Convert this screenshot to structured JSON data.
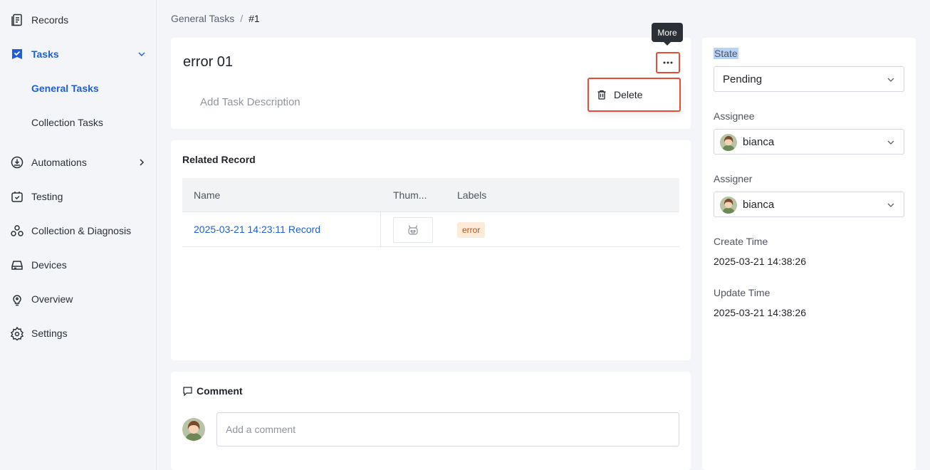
{
  "sidebar": {
    "items": [
      {
        "label": "Records",
        "icon": "records-icon"
      },
      {
        "label": "Tasks",
        "icon": "tasks-icon"
      },
      {
        "label": "Automations",
        "icon": "automations-icon"
      },
      {
        "label": "Testing",
        "icon": "testing-icon"
      },
      {
        "label": "Collection & Diagnosis",
        "icon": "diagnosis-icon"
      },
      {
        "label": "Devices",
        "icon": "devices-icon"
      },
      {
        "label": "Overview",
        "icon": "overview-icon"
      },
      {
        "label": "Settings",
        "icon": "settings-icon"
      }
    ],
    "sub_items": [
      {
        "label": "General Tasks"
      },
      {
        "label": "Collection Tasks"
      }
    ],
    "accent": "#1f5fd6"
  },
  "breadcrumb": {
    "parent": "General Tasks",
    "separator": "/",
    "current": "#1"
  },
  "task": {
    "title": "error 01",
    "description_placeholder": "Add Task Description",
    "more_tooltip": "More",
    "menu": {
      "delete_label": "Delete"
    }
  },
  "related": {
    "title": "Related Record",
    "columns": [
      "Name",
      "Thum...",
      "Labels"
    ],
    "rows": [
      {
        "name": "2025-03-21 14:23:11 Record",
        "thumbnail": "robot-icon",
        "label": "error"
      }
    ]
  },
  "comment": {
    "title": "Comment",
    "placeholder": "Add a comment"
  },
  "details": {
    "state_label": "State",
    "state_value": "Pending",
    "assignee_label": "Assignee",
    "assignee_value": "bianca",
    "assigner_label": "Assigner",
    "assigner_value": "bianca",
    "create_label": "Create Time",
    "create_value": "2025-03-21 14:38:26",
    "update_label": "Update Time",
    "update_value": "2025-03-21 14:38:26"
  },
  "colors": {
    "highlight_border": "#e84b36",
    "label_bg": "#fdebd9",
    "label_text": "#b3521b",
    "link": "#1f5fd6"
  }
}
